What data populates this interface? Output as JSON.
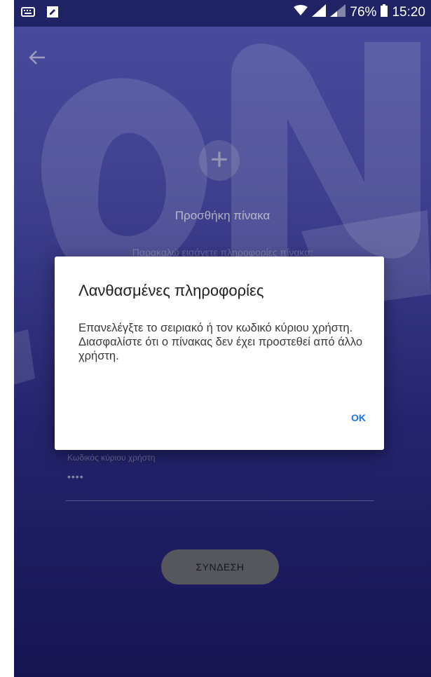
{
  "status_bar": {
    "battery": "76%",
    "time": "15:20",
    "icons": [
      "keyboard-icon",
      "edit-icon",
      "wifi-icon",
      "signal-icon",
      "signal-icon-2",
      "battery-icon"
    ]
  },
  "header": {
    "back_icon": "back-arrow-icon"
  },
  "screen": {
    "add_icon": "plus-icon",
    "title": "Προσθήκη πίνακα",
    "subtitle": "Παρακαλώ εισάγετε πληροφορίες πίνακα:",
    "field_label": "Κωδικός κύριου χρήστη",
    "field_value": "••••",
    "connect_button": "ΣΥΝΔΕΣΗ"
  },
  "dialog": {
    "title": "Λανθασμένες πληροφορίες",
    "message": "Επανελέγξτε το σειριακό ή τον κωδικό κύριου χρήστη. Διασφαλίστε ότι ο πίνακας δεν έχει προστεθεί από άλλο χρήστη.",
    "ok": "OK"
  },
  "watermark": [
    "ON",
    "BUTION"
  ],
  "colors": {
    "accent": "#1a73e8",
    "status_bar": "#202266",
    "gradient_top": "#5e62cc",
    "gradient_bottom": "#1c1a68"
  }
}
